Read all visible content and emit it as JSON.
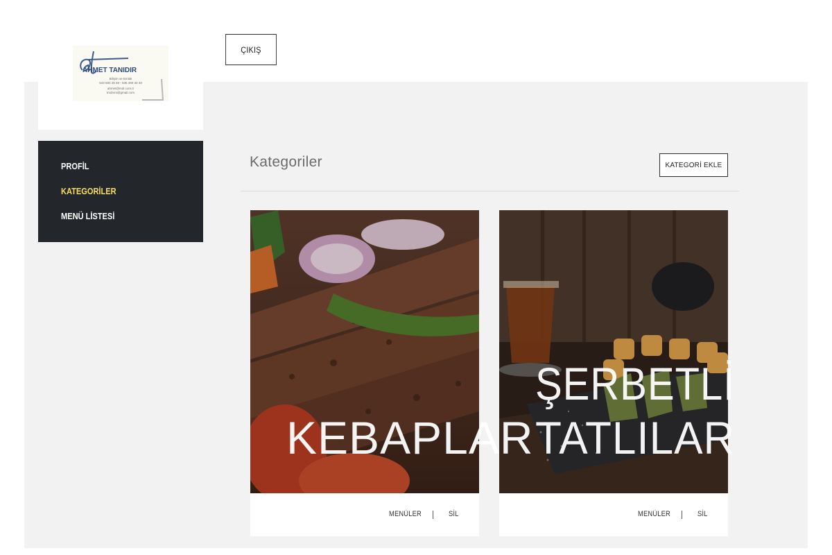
{
  "header": {
    "exit_label": "ÇIKIŞ"
  },
  "logo": {
    "monogram": "at",
    "name": "AHMET TANIDIR",
    "tagline": "Bilişim ve Emlak",
    "phones": "543 580 48 48 - 535 460 33 33",
    "email1": "ahmet@mdr.com.tr",
    "email2": "tmdrvm@gmail.com"
  },
  "sidebar": {
    "items": [
      {
        "label": "PROFİL",
        "active": false
      },
      {
        "label": "KATEGORİLER",
        "active": true
      },
      {
        "label": "MENÜ LİSTESİ",
        "active": false
      }
    ]
  },
  "main": {
    "title": "Kategoriler",
    "add_label": "KATEGORİ EKLE"
  },
  "categories": [
    {
      "title_lines": [
        "",
        "KEBAPLAR"
      ],
      "image": "kebab-photo",
      "menus_label": "MENÜLER",
      "delete_label": "SİL"
    },
    {
      "title_lines": [
        "ŞERBETLİ",
        "TATLILAR"
      ],
      "image": "baklava-tea-photo",
      "menus_label": "MENÜLER",
      "delete_label": "SİL"
    }
  ],
  "colors": {
    "sidebar_bg": "#23272b",
    "active_nav": "#f5dc64",
    "content_bg": "#f2f2f2"
  }
}
